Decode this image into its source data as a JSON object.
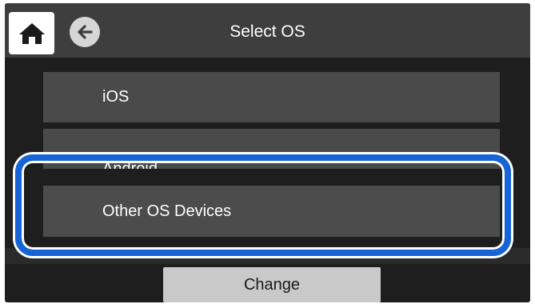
{
  "header": {
    "title": "Select OS",
    "home_icon": "home-icon",
    "back_icon": "back-arrow-icon"
  },
  "os_list": {
    "items": [
      {
        "label": "iOS"
      },
      {
        "label": "Android"
      },
      {
        "label": "Other OS Devices"
      }
    ],
    "highlighted_item": "Other OS Devices"
  },
  "footer": {
    "change_label": "Change"
  },
  "colors": {
    "highlight": "#1565d8",
    "item_bg": "#4a4a4a",
    "topbar_bg": "#3e3e3e"
  }
}
